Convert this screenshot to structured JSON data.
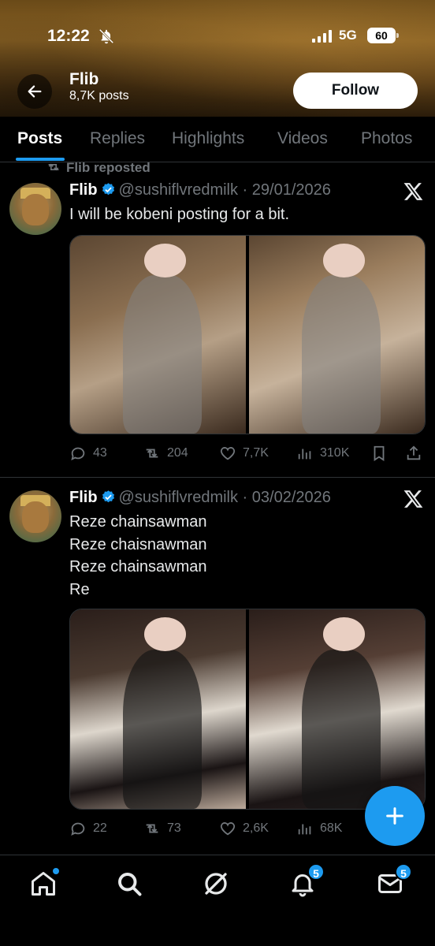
{
  "status_bar": {
    "time": "12:22",
    "network": "5G",
    "battery": "60"
  },
  "header": {
    "name": "Flib",
    "posts_count": "8,7K posts",
    "follow_label": "Follow"
  },
  "tabs": [
    {
      "label": "Posts",
      "active": true
    },
    {
      "label": "Replies"
    },
    {
      "label": "Highlights"
    },
    {
      "label": "Videos"
    },
    {
      "label": "Photos"
    }
  ],
  "posts": [
    {
      "repost_label": "Flib reposted",
      "author": "Flib",
      "handle": "@sushiflvredmilk",
      "date": "29/01/2026",
      "text_lines": [
        "I will be kobeni posting for a bit."
      ],
      "replies": "43",
      "reposts": "204",
      "likes": "7,7K",
      "views": "310K"
    },
    {
      "author": "Flib",
      "handle": "@sushiflvredmilk",
      "date": "03/02/2026",
      "text_lines": [
        "Reze chainsawman",
        "Reze chaisnawman",
        "Reze chainsawman",
        "Re"
      ],
      "replies": "22",
      "reposts": "73",
      "likes": "2,6K",
      "views": "68K"
    }
  ],
  "bottom_nav": {
    "items": [
      "home-icon",
      "search-icon",
      "grok-icon",
      "notifications-icon",
      "messages-icon"
    ],
    "notifications_badge": "5",
    "messages_badge": "5"
  },
  "colors": {
    "accent": "#1d9bf0",
    "text_muted": "#71767b",
    "divider": "#2f3336"
  }
}
